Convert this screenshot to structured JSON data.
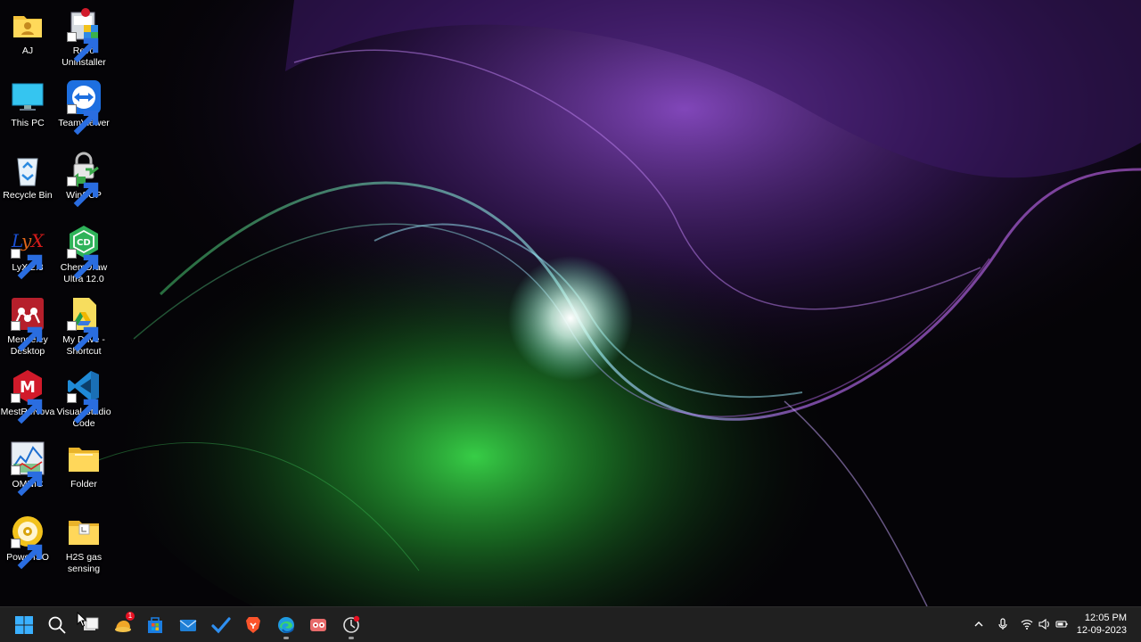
{
  "desktop": {
    "icons": [
      {
        "label": "AJ",
        "icon": "user-folder-icon"
      },
      {
        "label": "Revo\nUninstaller",
        "icon": "revo-uninstaller-icon"
      },
      {
        "label": "This PC",
        "icon": "monitor-icon"
      },
      {
        "label": "TeamViewer",
        "icon": "teamviewer-icon"
      },
      {
        "label": "Recycle Bin",
        "icon": "recycle-bin-icon"
      },
      {
        "label": "WinSCP",
        "icon": "winscp-icon"
      },
      {
        "label": "LyX 2.3",
        "icon": "lyx-icon"
      },
      {
        "label": "ChemDraw\nUltra 12.0",
        "icon": "chemdraw-icon"
      },
      {
        "label": "Mendeley\nDesktop",
        "icon": "mendeley-icon"
      },
      {
        "label": "My Drive -\nShortcut",
        "icon": "google-drive-icon"
      },
      {
        "label": "MestReNova",
        "icon": "mestrenova-icon"
      },
      {
        "label": "Visual Studio\nCode",
        "icon": "vscode-icon"
      },
      {
        "label": "OMNIC",
        "icon": "omnic-icon"
      },
      {
        "label": "Folder",
        "icon": "folder-icon"
      },
      {
        "label": "PowerISO",
        "icon": "poweriso-icon"
      },
      {
        "label": "H2S gas\nsensing",
        "icon": "folder-icon"
      }
    ]
  },
  "taskbar": {
    "apps": [
      {
        "name": "start",
        "icon": "windows-start-icon"
      },
      {
        "name": "search",
        "icon": "search-icon"
      },
      {
        "name": "task-view",
        "icon": "task-view-icon"
      },
      {
        "name": "widgets",
        "icon": "widgets-icon",
        "badge": "1"
      },
      {
        "name": "microsoft-store",
        "icon": "store-icon"
      },
      {
        "name": "mail",
        "icon": "mail-icon"
      },
      {
        "name": "todo",
        "icon": "todo-check-icon"
      },
      {
        "name": "brave",
        "icon": "brave-browser-icon"
      },
      {
        "name": "edge",
        "icon": "edge-browser-icon"
      },
      {
        "name": "app-red",
        "icon": "app-icon"
      },
      {
        "name": "recorder",
        "icon": "screen-recorder-icon"
      }
    ],
    "tray": {
      "overflow_icon": "chevron-up-icon",
      "mic_icon": "microphone-icon",
      "wifi_icon": "wifi-icon",
      "volume_icon": "volume-icon",
      "battery_icon": "battery-icon"
    },
    "clock": {
      "time": "12:05 PM",
      "date": "12-09-2023"
    }
  },
  "colors": {
    "taskbar_bg": "#202020",
    "wallpaper_purple": "#8a3fd0",
    "wallpaper_green": "#2fb83a",
    "wallpaper_dark": "#050407"
  }
}
